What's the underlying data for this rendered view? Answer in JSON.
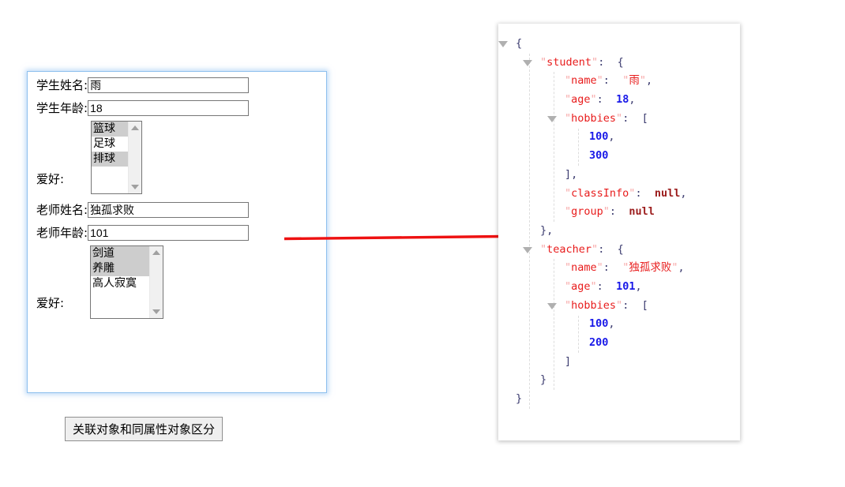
{
  "form": {
    "student_name_label": "学生姓名:",
    "student_name_value": "雨",
    "student_age_label": "学生年龄:",
    "student_age_value": "18",
    "student_hobby_label": "爱好:",
    "student_hobby_options": [
      {
        "label": "篮球",
        "selected": true
      },
      {
        "label": "足球",
        "selected": false
      },
      {
        "label": "排球",
        "selected": true
      }
    ],
    "teacher_name_label": "老师姓名:",
    "teacher_name_value": "独孤求败",
    "teacher_age_label": "老师年龄:",
    "teacher_age_value": "101",
    "teacher_hobby_label": "爱好:",
    "teacher_hobby_options": [
      {
        "label": "剑道",
        "selected": true
      },
      {
        "label": "养雕",
        "selected": true
      },
      {
        "label": "高人寂寞",
        "selected": false
      }
    ],
    "submit_label": "关联对象和同属性对象区分"
  },
  "json_viewer": {
    "lines": [
      {
        "indent": 0,
        "twisty": true,
        "tokens": [
          {
            "t": "pun",
            "v": "{"
          }
        ]
      },
      {
        "indent": 1,
        "twisty": true,
        "tokens": [
          {
            "t": "q",
            "v": "\""
          },
          {
            "t": "k",
            "v": "student"
          },
          {
            "t": "q",
            "v": "\""
          },
          {
            "t": "pun",
            "v": ":  {"
          }
        ]
      },
      {
        "indent": 2,
        "twisty": false,
        "tokens": [
          {
            "t": "q",
            "v": "\""
          },
          {
            "t": "k",
            "v": "name"
          },
          {
            "t": "q",
            "v": "\""
          },
          {
            "t": "pun",
            "v": ":  "
          },
          {
            "t": "q",
            "v": "\""
          },
          {
            "t": "str",
            "v": "雨"
          },
          {
            "t": "q",
            "v": "\""
          },
          {
            "t": "pun",
            "v": ","
          }
        ]
      },
      {
        "indent": 2,
        "twisty": false,
        "tokens": [
          {
            "t": "q",
            "v": "\""
          },
          {
            "t": "k",
            "v": "age"
          },
          {
            "t": "q",
            "v": "\""
          },
          {
            "t": "pun",
            "v": ":  "
          },
          {
            "t": "num",
            "v": "18"
          },
          {
            "t": "pun",
            "v": ","
          }
        ]
      },
      {
        "indent": 2,
        "twisty": true,
        "tokens": [
          {
            "t": "q",
            "v": "\""
          },
          {
            "t": "k",
            "v": "hobbies"
          },
          {
            "t": "q",
            "v": "\""
          },
          {
            "t": "pun",
            "v": ":  ["
          }
        ]
      },
      {
        "indent": 3,
        "twisty": false,
        "tokens": [
          {
            "t": "num",
            "v": "100"
          },
          {
            "t": "pun",
            "v": ","
          }
        ]
      },
      {
        "indent": 3,
        "twisty": false,
        "tokens": [
          {
            "t": "num",
            "v": "300"
          }
        ]
      },
      {
        "indent": 2,
        "twisty": false,
        "tokens": [
          {
            "t": "pun",
            "v": "],"
          }
        ]
      },
      {
        "indent": 2,
        "twisty": false,
        "tokens": [
          {
            "t": "q",
            "v": "\""
          },
          {
            "t": "k",
            "v": "classInfo"
          },
          {
            "t": "q",
            "v": "\""
          },
          {
            "t": "pun",
            "v": ":  "
          },
          {
            "t": "nul",
            "v": "null"
          },
          {
            "t": "pun",
            "v": ","
          }
        ]
      },
      {
        "indent": 2,
        "twisty": false,
        "tokens": [
          {
            "t": "q",
            "v": "\""
          },
          {
            "t": "k",
            "v": "group"
          },
          {
            "t": "q",
            "v": "\""
          },
          {
            "t": "pun",
            "v": ":  "
          },
          {
            "t": "nul",
            "v": "null"
          }
        ]
      },
      {
        "indent": 1,
        "twisty": false,
        "tokens": [
          {
            "t": "pun",
            "v": "},"
          }
        ]
      },
      {
        "indent": 1,
        "twisty": true,
        "tokens": [
          {
            "t": "q",
            "v": "\""
          },
          {
            "t": "k",
            "v": "teacher"
          },
          {
            "t": "q",
            "v": "\""
          },
          {
            "t": "pun",
            "v": ":  {"
          }
        ]
      },
      {
        "indent": 2,
        "twisty": false,
        "tokens": [
          {
            "t": "q",
            "v": "\""
          },
          {
            "t": "k",
            "v": "name"
          },
          {
            "t": "q",
            "v": "\""
          },
          {
            "t": "pun",
            "v": ":  "
          },
          {
            "t": "q",
            "v": "\""
          },
          {
            "t": "str",
            "v": "独孤求败"
          },
          {
            "t": "q",
            "v": "\""
          },
          {
            "t": "pun",
            "v": ","
          }
        ]
      },
      {
        "indent": 2,
        "twisty": false,
        "tokens": [
          {
            "t": "q",
            "v": "\""
          },
          {
            "t": "k",
            "v": "age"
          },
          {
            "t": "q",
            "v": "\""
          },
          {
            "t": "pun",
            "v": ":  "
          },
          {
            "t": "num",
            "v": "101"
          },
          {
            "t": "pun",
            "v": ","
          }
        ]
      },
      {
        "indent": 2,
        "twisty": true,
        "tokens": [
          {
            "t": "q",
            "v": "\""
          },
          {
            "t": "k",
            "v": "hobbies"
          },
          {
            "t": "q",
            "v": "\""
          },
          {
            "t": "pun",
            "v": ":  ["
          }
        ]
      },
      {
        "indent": 3,
        "twisty": false,
        "tokens": [
          {
            "t": "num",
            "v": "100"
          },
          {
            "t": "pun",
            "v": ","
          }
        ]
      },
      {
        "indent": 3,
        "twisty": false,
        "tokens": [
          {
            "t": "num",
            "v": "200"
          }
        ]
      },
      {
        "indent": 2,
        "twisty": false,
        "tokens": [
          {
            "t": "pun",
            "v": "]"
          }
        ]
      },
      {
        "indent": 1,
        "twisty": false,
        "tokens": [
          {
            "t": "pun",
            "v": "}"
          }
        ]
      },
      {
        "indent": 0,
        "twisty": false,
        "tokens": [
          {
            "t": "pun",
            "v": "}"
          }
        ]
      }
    ]
  },
  "annotation": {
    "arrow_color": "#ee1111",
    "arrow_name": "red-pointer-arrow"
  },
  "colors": {
    "form_border": "#8ec0ee",
    "json_key": "#e81c1c",
    "json_number": "#1818e8",
    "json_null": "#9b1b1b"
  }
}
